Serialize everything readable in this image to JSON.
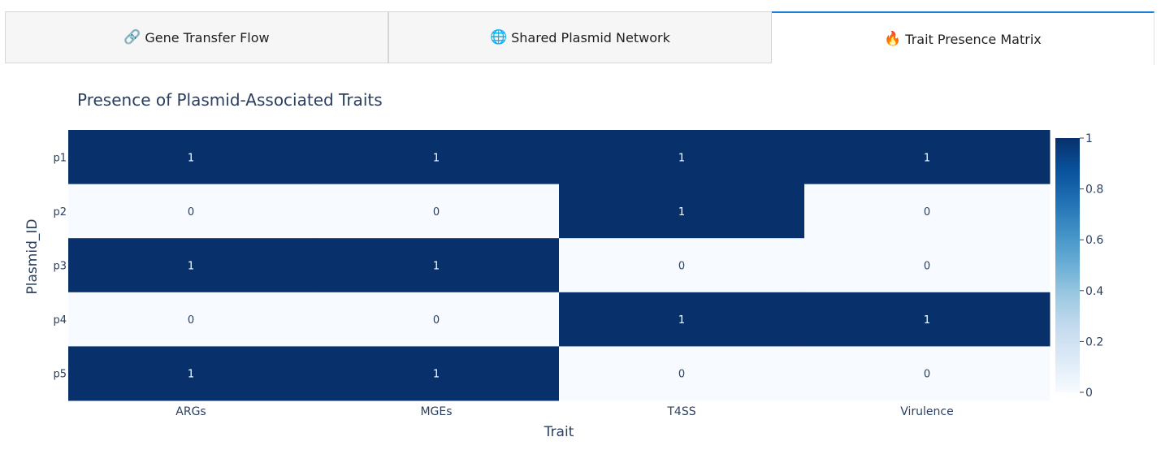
{
  "tabs": [
    {
      "label": "Gene Transfer Flow",
      "icon": "link-icon",
      "glyph": "🔗",
      "active": false
    },
    {
      "label": "Shared Plasmid Network",
      "icon": "globe-icon",
      "glyph": "🌐",
      "active": false
    },
    {
      "label": "Trait Presence Matrix",
      "icon": "fire-icon",
      "glyph": "🔥",
      "active": true
    }
  ],
  "chart_data": {
    "type": "heatmap",
    "title": "Presence of Plasmid-Associated Traits",
    "xlabel": "Trait",
    "ylabel": "Plasmid_ID",
    "x": [
      "ARGs",
      "MGEs",
      "T4SS",
      "Virulence"
    ],
    "y": [
      "p1",
      "p2",
      "p3",
      "p4",
      "p5"
    ],
    "z": [
      [
        1,
        1,
        1,
        1
      ],
      [
        0,
        0,
        1,
        0
      ],
      [
        1,
        1,
        0,
        0
      ],
      [
        0,
        0,
        1,
        1
      ],
      [
        1,
        1,
        0,
        0
      ]
    ],
    "zrange": [
      0,
      1
    ],
    "colorbar_ticks": [
      "0",
      "0.2",
      "0.4",
      "0.6",
      "0.8",
      "1"
    ],
    "colorscale": [
      "#f7fbff",
      "#deebf7",
      "#c6dbef",
      "#9ecae1",
      "#6baed6",
      "#4292c6",
      "#2171b5",
      "#08519c",
      "#08306b"
    ]
  }
}
